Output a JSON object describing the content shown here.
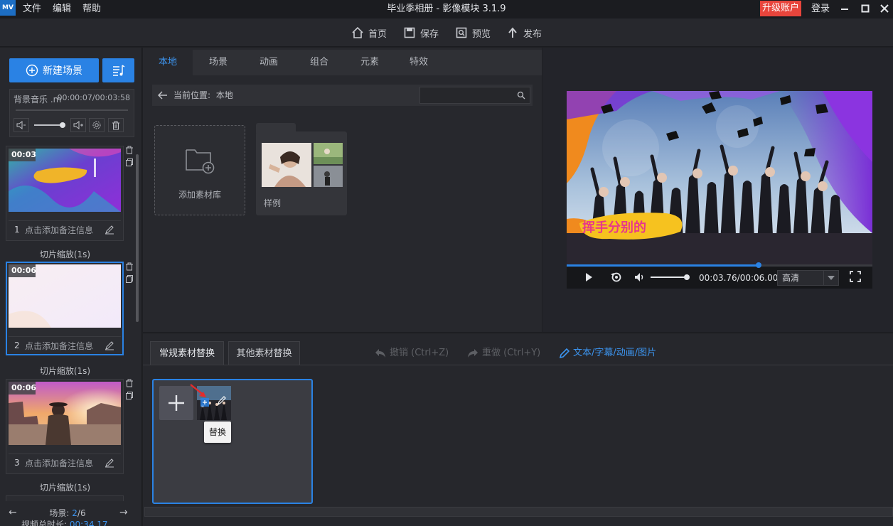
{
  "app": {
    "title": "毕业季相册 - 影像模块 3.1.9",
    "logo_text": "MV",
    "menus": [
      "文件",
      "编辑",
      "帮助"
    ],
    "upgrade_label": "升级账户",
    "login_label": "登录",
    "accent_color": "#2a82e4",
    "upgrade_color": "#e8453c"
  },
  "toolbar": {
    "home": "首页",
    "save": "保存",
    "preview": "预览",
    "publish": "发布"
  },
  "left": {
    "new_scene": "新建场景",
    "music_name": "背景音乐 .m",
    "music_time": "00:00:07/00:03:58",
    "volume_level": 0.9,
    "scenes": [
      {
        "duration": "00:03",
        "number": "1",
        "note": "点击添加备注信息"
      },
      {
        "duration": "00:06",
        "number": "2",
        "note": "点击添加备注信息"
      },
      {
        "duration": "00:06",
        "number": "3",
        "note": "点击添加备注信息"
      }
    ],
    "transitions": [
      "切片缩放(1s)",
      "切片缩放(1s)",
      "切片缩放(1s)"
    ],
    "scene_label": "场景:",
    "scene_current": "2",
    "scene_total": "/6",
    "total_label": "视频总时长:",
    "total_value": "00:34.17"
  },
  "library": {
    "tabs": [
      "本地",
      "场景",
      "动画",
      "组合",
      "元素",
      "特效"
    ],
    "active_tab": 0,
    "location_label": "当前位置:",
    "location_value": "本地",
    "search_placeholder": "",
    "add_library": "添加素材库",
    "folder_name": "样例"
  },
  "player": {
    "caption": "挥手分别的",
    "time": "00:03.76/00:06.00",
    "quality": "高清",
    "progress": 0.627
  },
  "bottom": {
    "tab_regular": "常规素材替换",
    "tab_other": "其他素材替换",
    "undo": "撤销 (Ctrl+Z)",
    "redo": "重做 (Ctrl+Y)",
    "text_link": "文本/字幕/动画/图片",
    "tooltip": "替换"
  }
}
